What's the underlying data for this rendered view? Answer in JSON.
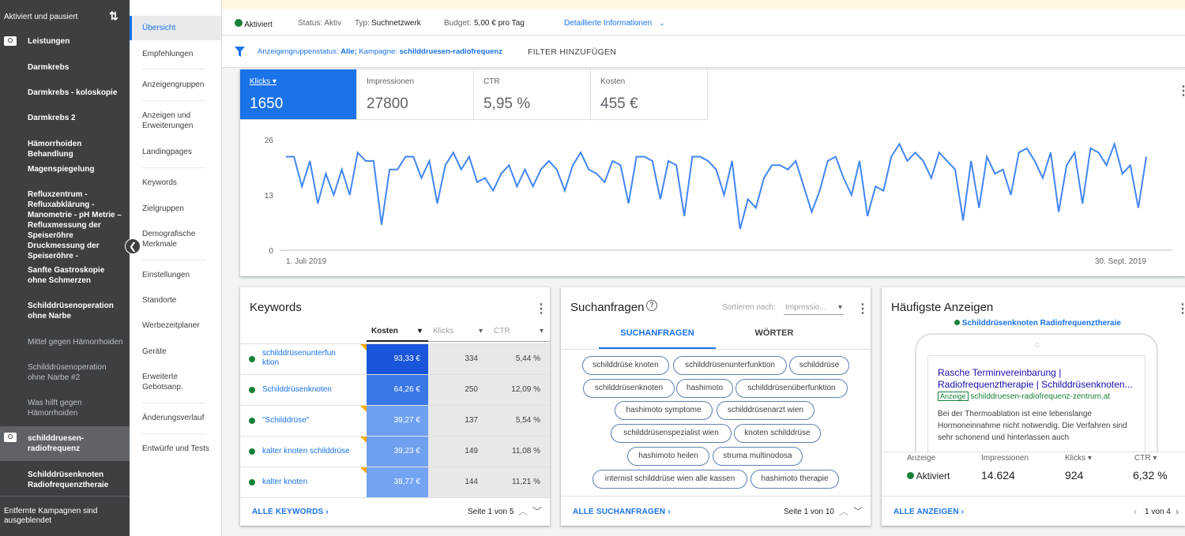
{
  "sidebar": {
    "header": "Aktiviert und pausiert",
    "items": [
      {
        "label": "Leistungen"
      },
      {
        "label": "Darmkrebs"
      },
      {
        "label": "Darmkrebs - koloskopie"
      },
      {
        "label": "Darmkrebs 2"
      },
      {
        "label": "Hämorrhoiden Behandlung"
      },
      {
        "label": "Magenspiegelung"
      },
      {
        "label": "Refluxzentrum - Refluxabklärung - Manometrie - pH Metrie – Refluxmessung der Speiseröhre Druckmessung der Speiseröhre -"
      },
      {
        "label": "Sanfte Gastroskopie ohne Schmerzen"
      },
      {
        "label": "Schilddrüsenoperation ohne Narbe"
      },
      {
        "label": "Mittel gegen Hämorrhoiden"
      },
      {
        "label": "Schilddrüsenoperation ohne Narbe #2"
      },
      {
        "label": "Was hilft gegen Hämorrhoiden"
      },
      {
        "label": "schilddruesen-radiofrequenz"
      },
      {
        "label": "Schilddrüsenknoten Radiofrequenztheraie"
      }
    ],
    "footer": "Entfernte Kampagnen sind ausgeblendet"
  },
  "nav": {
    "items": [
      {
        "label": "Übersicht"
      },
      {
        "label": "Empfehlungen"
      },
      {
        "label": "Anzeigengruppen"
      },
      {
        "label": "Anzeigen und Erweiterungen"
      },
      {
        "label": "Landingpages"
      },
      {
        "label": "Keywords"
      },
      {
        "label": "Zielgruppen"
      },
      {
        "label": "Demografische Merkmale"
      },
      {
        "label": "Einstellungen"
      },
      {
        "label": "Standorte"
      },
      {
        "label": "Werbezeitplaner"
      },
      {
        "label": "Geräte"
      },
      {
        "label": "Erweiterte Gebotsanp."
      },
      {
        "label": "Änderungsverlauf"
      },
      {
        "label": "Entwürfe und Tests"
      }
    ]
  },
  "status": {
    "state": "Aktiviert",
    "status": "Status: Aktiv",
    "type_label": "Typ:",
    "type_value": "Suchnetzwerk",
    "budget_label": "Budget:",
    "budget_value": "5,00 € pro Tag",
    "details": "Detaillierte Informationen"
  },
  "filter": {
    "f1_label": "Anzeigengruppenstatus:",
    "f1_value": "Alle;",
    "f2_label": "Kampagne:",
    "f2_value": "schilddruesen-radiofrequenz",
    "add": "FILTER HINZUFÜGEN"
  },
  "metrics": [
    {
      "label": "Klicks",
      "value": "1650"
    },
    {
      "label": "Impressionen",
      "value": "27800"
    },
    {
      "label": "CTR",
      "value": "5,95 %"
    },
    {
      "label": "Kosten",
      "value": "455 €"
    }
  ],
  "chart_data": {
    "type": "line",
    "series": [
      {
        "values": [
          22,
          22,
          15,
          21,
          11,
          18,
          13,
          19,
          13,
          23,
          21,
          21,
          6,
          19,
          19,
          22,
          22,
          17,
          21,
          11,
          20,
          23,
          19,
          22,
          16,
          17,
          14,
          18,
          20,
          15,
          19,
          15,
          19,
          21,
          19,
          14,
          20,
          23,
          19,
          18,
          16,
          21,
          20,
          11,
          22,
          22,
          21,
          12,
          21,
          20,
          8,
          22,
          22,
          21,
          19,
          13,
          21,
          5,
          12,
          10,
          17,
          20,
          20,
          19,
          21,
          15,
          9,
          14,
          21,
          22,
          17,
          13,
          21,
          8,
          15,
          14,
          22,
          25,
          21,
          23,
          21,
          17,
          23,
          21,
          19,
          7,
          21,
          10,
          22,
          18,
          19,
          13,
          23,
          24,
          21,
          17,
          23,
          9,
          20,
          23,
          11,
          24,
          23,
          20,
          25,
          18,
          20,
          10,
          22
        ]
      }
    ],
    "x_start": "1. Juli 2019",
    "x_end": "30. Sept. 2019",
    "y_ticks": [
      "26",
      "13",
      "0"
    ],
    "ylim": [
      0,
      26
    ],
    "color": "#4285f4"
  },
  "keywords": {
    "title": "Keywords",
    "col_cost": "Kosten",
    "col_clicks": "Klicks",
    "col_ctr": "CTR",
    "rows": [
      {
        "kw": "schilddrüsenunterfunktion",
        "cost": "93,33 €",
        "clicks": "334",
        "ctr": "5,44 %",
        "shade": "#1a56db"
      },
      {
        "kw": "Schilddrüsenknoten",
        "cost": "64,26 €",
        "clicks": "250",
        "ctr": "12,09 %",
        "shade": "#3b78e7"
      },
      {
        "kw": "\"Schilddrüse\"",
        "cost": "39,27 €",
        "clicks": "137",
        "ctr": "5,54 %",
        "shade": "#6fa0f0"
      },
      {
        "kw": "kalter knoten schilddrüse",
        "cost": "39,23 €",
        "clicks": "149",
        "ctr": "11,08 %",
        "shade": "#6fa0f0"
      },
      {
        "kw": "kalter knoten",
        "cost": "38,77 €",
        "clicks": "144",
        "ctr": "11,21 %",
        "shade": "#74a4f1"
      }
    ],
    "all": "ALLE KEYWORDS",
    "page": "Seite 1 von 5"
  },
  "queries": {
    "title": "Suchanfragen",
    "sort_label": "Sortieren nach:",
    "sort_value": "Impressio...",
    "tab1": "SUCHANFRAGEN",
    "tab2": "WÖRTER",
    "chips": [
      "schilddrüse knoten",
      "schilddrüsenunterfunktion",
      "schilddrüse",
      "schilddrüsenknoten",
      "hashimoto",
      "schilddrüsenüberfunktion",
      "hashimoto symptome",
      "schilddrüsenarzt wien",
      "schilddrüsenspezialist wien",
      "knoten schilddrüse",
      "hashimoto heilen",
      "struma multinodosa",
      "internist schilddrüse wien alle kassen",
      "hashimoto therapie"
    ],
    "all": "ALLE SUCHANFRAGEN",
    "page": "Seite 1 von 10"
  },
  "ads": {
    "title": "Häufigste Anzeigen",
    "adgroup": "Schilddrüsenknoten Radiofrequenztheraie",
    "headline": "Rasche Terminvereinbarung | Radiofrequenztherapie | Schilddrüsenknoten...",
    "badge": "Anzeige",
    "url": "schilddruesen-radiofrequenz-zentrum.at",
    "desc": "Bei der Thermoablation ist eine lebenslange Hormoneinnahme nicht notwendig. Die Verfahren sind sehr schonend und hinterlassen auch",
    "col_ad": "Anzeige",
    "col_impr": "Impressionen",
    "col_clicks": "Klicks",
    "col_ctr": "CTR",
    "state": "Aktiviert",
    "impr": "14.624",
    "clicks": "924",
    "ctr": "6,32 %",
    "all": "ALLE ANZEIGEN",
    "page": "1 von 4"
  }
}
